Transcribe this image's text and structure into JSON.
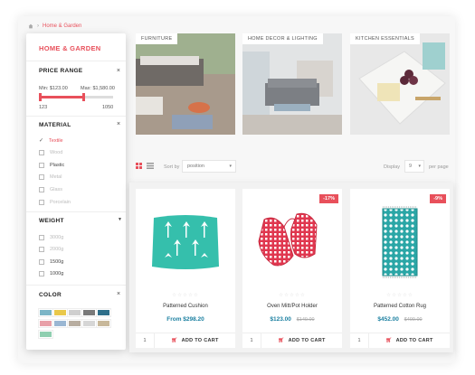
{
  "breadcrumb": {
    "current": "Home & Garden"
  },
  "sidebar": {
    "title": "HOME & GARDEN",
    "price_range": {
      "heading": "PRICE RANGE",
      "min_label": "Min: $123.00",
      "max_label": "Max: $1,580.00",
      "min_value": "123",
      "max_value": "1050",
      "min_fraction": 0.0,
      "max_fraction": 0.62
    },
    "material": {
      "heading": "MATERIAL",
      "items": [
        "Textile",
        "Wood",
        "Plastic",
        "Metal",
        "Glass",
        "Porcelain"
      ]
    },
    "weight": {
      "heading": "WEIGHT",
      "items": [
        "3000g",
        "2000g",
        "1500g",
        "1000g"
      ]
    },
    "color": {
      "heading": "COLOR",
      "swatches": [
        "#7bb5c6",
        "#e9c84a",
        "#cfcfcf",
        "#7a7a7a",
        "#2f6f8a",
        "#e8a0a8",
        "#9ab7d3",
        "#b8ada0",
        "#d6d6d6",
        "#c8b89a",
        "#8fcfb0"
      ]
    }
  },
  "categories": [
    {
      "label": "FURNITURE"
    },
    {
      "label": "HOME DECOR & LIGHTING"
    },
    {
      "label": "KITCHEN ESSENTIALS"
    }
  ],
  "toolbar": {
    "sort_label": "Sort by",
    "sort_value": "position",
    "display_label": "Display",
    "display_value": "9",
    "per_page": "per page"
  },
  "products": [
    {
      "name": "Patterned Cushion",
      "price_prefix": "From",
      "price": "$298.20",
      "old_price": "",
      "badge": "",
      "qty": "1",
      "cart": "ADD TO CART"
    },
    {
      "name": "Oven Mitt/Pot Holder",
      "price_prefix": "",
      "price": "$123.00",
      "old_price": "$149.00",
      "badge": "-17%",
      "qty": "1",
      "cart": "ADD TO CART"
    },
    {
      "name": "Patterned Cotton Rug",
      "price_prefix": "",
      "price": "$452.00",
      "old_price": "$499.00",
      "badge": "-9%",
      "qty": "1",
      "cart": "ADD TO CART"
    }
  ],
  "colors": {
    "accent": "#e8505b",
    "price": "#1a7fa0"
  }
}
